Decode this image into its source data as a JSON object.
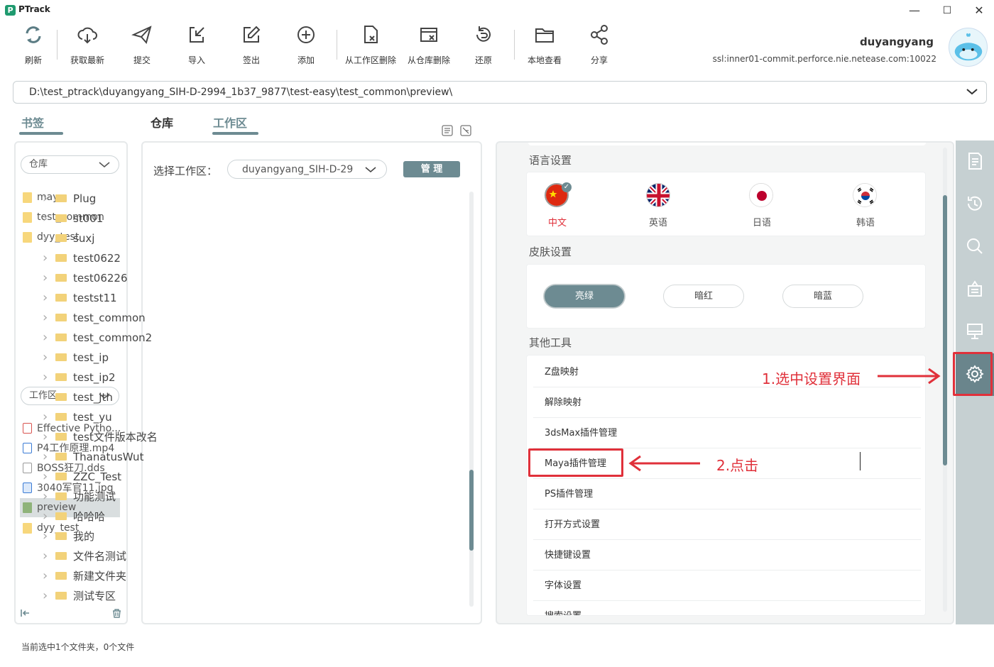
{
  "app": {
    "title": "PTrack",
    "logo_letter": "P"
  },
  "window": {
    "minimize": "—",
    "maximize": "☐",
    "close": "✕"
  },
  "toolbar": [
    {
      "label": "刷新",
      "icon": "refresh-icon"
    },
    {
      "label": "获取最新",
      "icon": "cloud-download-icon"
    },
    {
      "label": "提交",
      "icon": "send-icon"
    },
    {
      "label": "导入",
      "icon": "import-icon"
    },
    {
      "label": "签出",
      "icon": "edit-icon"
    },
    {
      "label": "添加",
      "icon": "add-icon"
    },
    {
      "label": "从工作区删除",
      "icon": "file-delete-icon"
    },
    {
      "label": "从仓库删除",
      "icon": "repo-delete-icon"
    },
    {
      "label": "还原",
      "icon": "revert-icon"
    },
    {
      "label": "本地查看",
      "icon": "folder-icon"
    },
    {
      "label": "分享",
      "icon": "share-icon"
    }
  ],
  "user": {
    "name": "duyangyang",
    "server": "ssl:inner01-commit.perforce.nie.netease.com:10022"
  },
  "path": "D:\\test_ptrack\\duyangyang_SIH-D-2994_1b37_9877\\test-easy\\test_common\\preview\\",
  "tabs": {
    "bookmarks": "书签",
    "repo": "仓库",
    "workspace": "工作区"
  },
  "bookmarks": {
    "repo_dropdown": "仓库",
    "repo_items": [
      "maya",
      "test_common",
      "dyy_test"
    ],
    "ws_dropdown": "工作区",
    "ws_items": [
      {
        "name": "Effective Pytho...",
        "type": "pdf"
      },
      {
        "name": "P4工作原理.mp4",
        "type": "video"
      },
      {
        "name": "BOSS狂刀.dds",
        "type": "file"
      },
      {
        "name": "3040军官11.jpg",
        "type": "image"
      },
      {
        "name": "preview",
        "type": "folder-green"
      },
      {
        "name": "dyy_test",
        "type": "folder"
      }
    ]
  },
  "workspace": {
    "label": "选择工作区：",
    "selected": "duyangyang_SIH-D-29",
    "manage": "管 理",
    "folders": [
      "Plug",
      "st001",
      "suxj",
      "test0622",
      "test06226",
      "testst11",
      "test_common",
      "test_common2",
      "test_ip",
      "test_ip2",
      "test_jth",
      "test_yu",
      "test文件版本改名",
      "ThanatusWut",
      "ZZC_Test",
      "功能测试",
      "哈哈哈",
      "我的",
      "文件名测试",
      "新建文件夹",
      "测试专区"
    ]
  },
  "settings": {
    "language_title": "语言设置",
    "languages": [
      "中文",
      "英语",
      "日语",
      "韩语"
    ],
    "skin_title": "皮肤设置",
    "skins": [
      "亮绿",
      "暗红",
      "暗蓝"
    ],
    "tools_title": "其他工具",
    "tools": [
      "Z盘映射",
      "解除映射",
      "3dsMax插件管理",
      "Maya插件管理",
      "PS插件管理",
      "打开方式设置",
      "快捷键设置",
      "字体设置",
      "搜索设置"
    ]
  },
  "annotations": {
    "step1": "1.选中设置界面",
    "step2": "2.点击"
  },
  "status": "当前选中1个文件夹，0个文件",
  "colors": {
    "accent": "#6d8b92",
    "annotation_red": "#e0303a",
    "sidebar": "#c6d0d2",
    "active_sidebar": "#6a858c"
  }
}
